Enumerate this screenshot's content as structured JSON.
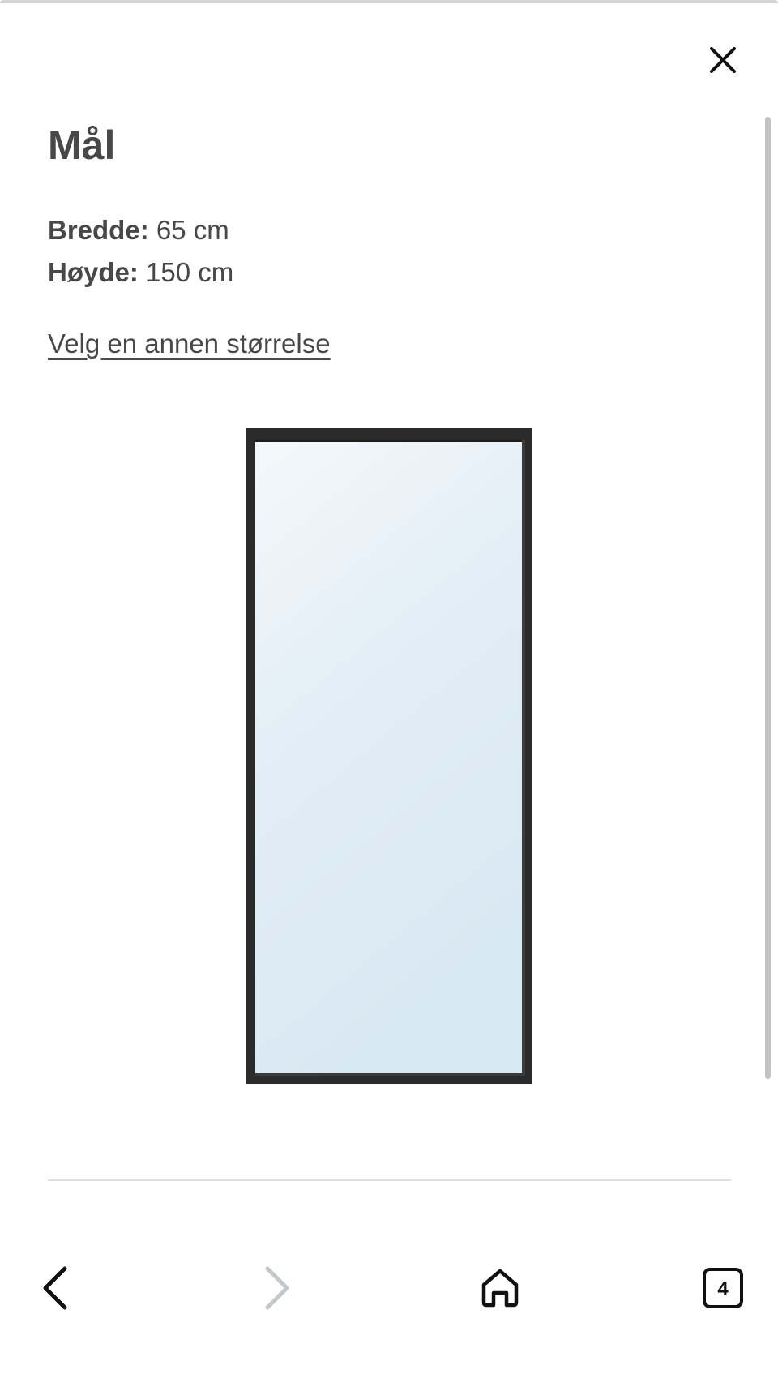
{
  "sheet": {
    "close_icon": "close-icon"
  },
  "content": {
    "title": "Mål",
    "dimensions": [
      {
        "label": "Bredde:",
        "value": "65 cm"
      },
      {
        "label": "Høyde:",
        "value": "150 cm"
      }
    ],
    "choose_size_link": "Velg en annen størrelse",
    "image": "mirror-product-image"
  },
  "browser_bar": {
    "back_icon": "chevron-left-icon",
    "forward_icon": "chevron-right-icon",
    "home_icon": "home-icon",
    "tabs_icon": "tabs-icon",
    "tabs_count": "4"
  },
  "colors": {
    "text": "#484848",
    "frame": "#2b2b2b",
    "glass_top": "#f3f7fa",
    "glass_bottom": "#d9e9f3",
    "disabled": "#c3c7cc"
  }
}
